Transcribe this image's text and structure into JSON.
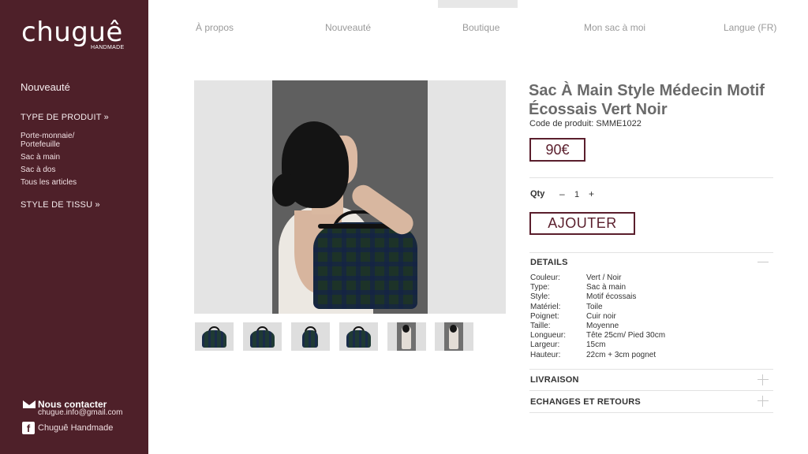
{
  "brand": {
    "name": "chuguê",
    "subtitle": "HANDMADE"
  },
  "nav": {
    "items": [
      "À propos",
      "Nouveauté",
      "Boutique",
      "Mon sac à moi",
      "Langue (FR)"
    ]
  },
  "sidebar": {
    "new_label": "Nouveauté",
    "product_type_label": "TYPE DE PRODUIT »",
    "product_types": [
      "Porte-monnaie/ Portefeuille",
      "Sac à main",
      "Sac à dos",
      "Tous les articles"
    ],
    "fabric_style_label": "STYLE DE TISSU »",
    "contact_title": "Nous contacter",
    "contact_email": "chugue.info@gmail.com",
    "facebook_label": "Chuguê Handmade"
  },
  "product": {
    "title": "Sac À Main Style Médecin Motif Écossais Vert Noir",
    "code": "Code de produit: SMME1022",
    "price": "90€",
    "qty_label": "Qty",
    "qty_minus": "–",
    "qty_value": "1",
    "qty_plus": "+",
    "add_button": "AJOUTER",
    "details_title": "DETAILS",
    "details": [
      {
        "key": "Couleur:",
        "value": "Vert / Noir"
      },
      {
        "key": "Type:",
        "value": "Sac à main"
      },
      {
        "key": "Style:",
        "value": "Motif écossais"
      },
      {
        "key": "Matériel:",
        "value": "Toile"
      },
      {
        "key": "Poignet:",
        "value": "Cuir noir"
      },
      {
        "key": "Taille:",
        "value": "Moyenne"
      },
      {
        "key": "Longueur:",
        "value": "Tête 25cm/ Pied 30cm"
      },
      {
        "key": "Largeur:",
        "value": "15cm"
      },
      {
        "key": "Hauteur:",
        "value": "22cm + 3cm pognet"
      }
    ],
    "shipping_title": "LIVRAISON",
    "returns_title": "ECHANGES ET RETOURS"
  },
  "colors": {
    "sidebar_bg": "#4e2029",
    "accent": "#5a1e2c"
  }
}
